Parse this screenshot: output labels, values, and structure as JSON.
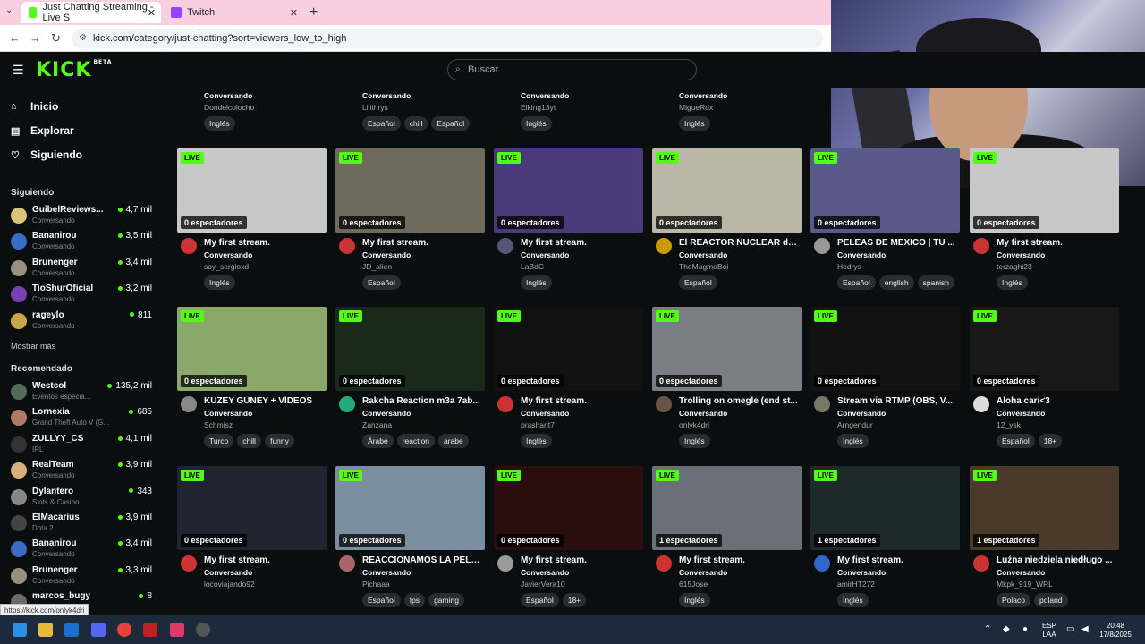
{
  "browser": {
    "tabs": [
      {
        "title": "Just Chatting Streaming - Live S",
        "active": true
      },
      {
        "title": "Twitch",
        "active": false
      }
    ],
    "url": "kick.com/category/just-chatting?sort=viewers_low_to_high",
    "status_url": "https://kick.com/onlyk4dri"
  },
  "header": {
    "logo": "KICK",
    "logo_badge": "BETA",
    "search_placeholder": "Buscar"
  },
  "sidebar": {
    "nav": [
      {
        "label": "Inicio",
        "icon": "home-icon"
      },
      {
        "label": "Explorar",
        "icon": "compass-icon"
      },
      {
        "label": "Siguiendo",
        "icon": "heart-icon"
      }
    ],
    "following_title": "Siguiendo",
    "following": [
      {
        "name": "GuibelReviews...",
        "category": "Conversando",
        "viewers": "4,7 mil",
        "color": "#d9c47a"
      },
      {
        "name": "Bananirou",
        "category": "Conversando",
        "viewers": "3,5 mil",
        "color": "#3a6cc8"
      },
      {
        "name": "Brunenger",
        "category": "Conversando",
        "viewers": "3,4 mil",
        "color": "#9a8f80"
      },
      {
        "name": "TioShurOficial",
        "category": "Conversando",
        "viewers": "3,2 mil",
        "color": "#7a3fb0"
      },
      {
        "name": "rageylo",
        "category": "Conversando",
        "viewers": "811",
        "color": "#c9a64a"
      }
    ],
    "show_more": "Mostrar más",
    "recommended_title": "Recomendado",
    "recommended": [
      {
        "name": "Westcol",
        "category": "Eventos especia...",
        "viewers": "135,2 mil",
        "color": "#556b5a"
      },
      {
        "name": "Lornexia",
        "category": "Grand Theft Auto V (G...",
        "viewers": "685",
        "color": "#b07a6a"
      },
      {
        "name": "ZULLYY_CS",
        "category": "IRL",
        "viewers": "4,1 mil",
        "color": "#333"
      },
      {
        "name": "RealTeam",
        "category": "Conversando",
        "viewers": "3,9 mil",
        "color": "#d9b07a"
      },
      {
        "name": "Dylantero",
        "category": "Slots & Casino",
        "viewers": "343",
        "color": "#888"
      },
      {
        "name": "ElMacarius",
        "category": "Dota 2",
        "viewers": "3,9 mil",
        "color": "#444"
      },
      {
        "name": "Bananirou",
        "category": "Conversando",
        "viewers": "3,4 mil",
        "color": "#3a6cc8"
      },
      {
        "name": "Brunenger",
        "category": "Conversando",
        "viewers": "3,3 mil",
        "color": "#9a8f80"
      },
      {
        "name": "marcos_bugy",
        "category": "",
        "viewers": "8",
        "color": "#6a6a6a"
      }
    ]
  },
  "top_row": [
    {
      "category": "Conversando",
      "user": "Dondelcolocho",
      "tags": [
        "Inglés"
      ]
    },
    {
      "category": "Conversando",
      "user": "Lilithrys",
      "tags": [
        "Español",
        "chill",
        "Español"
      ]
    },
    {
      "category": "Conversando",
      "user": "Elking13yt",
      "tags": [
        "Inglés"
      ]
    },
    {
      "category": "Conversando",
      "user": "MigueRdx",
      "tags": [
        "Inglés"
      ]
    }
  ],
  "grid": [
    [
      {
        "title": "My first stream.",
        "category": "Conversando",
        "user": "soy_sergioxd",
        "viewers": "0 espectadores",
        "tags": [
          "Inglés"
        ],
        "thumb": "#c8c8c8",
        "av": "#c33"
      },
      {
        "title": "My first stream.",
        "category": "Conversando",
        "user": "JD_alien",
        "viewers": "0 espectadores",
        "tags": [
          "Español"
        ],
        "thumb": "#6f6a5c",
        "av": "#c33"
      },
      {
        "title": "My first stream.",
        "category": "Conversando",
        "user": "LaBdC",
        "viewers": "0 espectadores",
        "tags": [
          "Inglés"
        ],
        "thumb": "#4a3a7a",
        "av": "#557"
      },
      {
        "title": "El REACTOR NUCLEAR de ...",
        "category": "Conversando",
        "user": "TheMagmaBoi",
        "viewers": "0 espectadores",
        "tags": [
          "Español"
        ],
        "thumb": "#bcb6a6",
        "av": "#c90"
      },
      {
        "title": "PELEAS DE MEXICO | TU ...",
        "category": "Conversando",
        "user": "Hedrys",
        "viewers": "0 espectadores",
        "tags": [
          "Español",
          "english",
          "spanish"
        ],
        "thumb": "#5a5a8a",
        "av": "#999"
      },
      {
        "title": "My first stream.",
        "category": "Conversando",
        "user": "terzaghi23",
        "viewers": "0 espectadores",
        "tags": [
          "Inglés"
        ],
        "thumb": "#c8c8c8",
        "av": "#c33"
      }
    ],
    [
      {
        "title": "KUZEY GÜNEY + VİDEOS",
        "category": "Conversando",
        "user": "Schmisz",
        "viewers": "0 espectadores",
        "tags": [
          "Turco",
          "chill",
          "funny"
        ],
        "thumb": "#8aa86a",
        "av": "#888"
      },
      {
        "title": "Rakcha Reaction m3a 7ab...",
        "category": "Conversando",
        "user": "Zanzana",
        "viewers": "0 espectadores",
        "tags": [
          "Árabe",
          "reaction",
          "arabe"
        ],
        "thumb": "#1a2a1a",
        "av": "#2a7"
      },
      {
        "title": "My first stream.",
        "category": "Conversando",
        "user": "prashant7",
        "viewers": "0 espectadores",
        "tags": [
          "Inglés"
        ],
        "thumb": "#111111",
        "av": "#c33"
      },
      {
        "title": "Trolling on omegle (end st...",
        "category": "Conversando",
        "user": "onlyk4dri",
        "viewers": "0 espectadores",
        "tags": [
          "Inglés"
        ],
        "thumb": "#7a7e84",
        "av": "#654"
      },
      {
        "title": "Stream via RTMP (OBS, V...",
        "category": "Conversando",
        "user": "Arngendur",
        "viewers": "0 espectadores",
        "tags": [
          "Inglés"
        ],
        "thumb": "#121212",
        "av": "#776"
      },
      {
        "title": "Aloha cari<3",
        "category": "Conversando",
        "user": "12_ysk",
        "viewers": "0 espectadores",
        "tags": [
          "Español",
          "18+"
        ],
        "thumb": "#181818",
        "av": "#ddd"
      }
    ],
    [
      {
        "title": "My first stream.",
        "category": "Conversando",
        "user": "locoviajando92",
        "viewers": "0 espectadores",
        "tags": [],
        "thumb": "#1f2530",
        "av": "#c33"
      },
      {
        "title": "REACCIONAMOS LA PELE...",
        "category": "Conversando",
        "user": "Pichaaa",
        "viewers": "0 espectadores",
        "tags": [
          "Español",
          "fps",
          "gaming"
        ],
        "thumb": "#7a8ea0",
        "av": "#a66"
      },
      {
        "title": "My first stream.",
        "category": "Conversando",
        "user": "JavierVera10",
        "viewers": "0 espectadores",
        "tags": [
          "Español",
          "18+"
        ],
        "thumb": "#2a0e0e",
        "av": "#999"
      },
      {
        "title": "My first stream.",
        "category": "Conversando",
        "user": "615Jose",
        "viewers": "1 espectadores",
        "tags": [
          "Inglés"
        ],
        "thumb": "#6a7078",
        "av": "#c33"
      },
      {
        "title": "My first stream.",
        "category": "Conversando",
        "user": "amirHT272",
        "viewers": "1 espectadores",
        "tags": [
          "Inglés"
        ],
        "thumb": "#1e2a2a",
        "av": "#36c"
      },
      {
        "title": "Luźna niedziela niedługo ...",
        "category": "Conversando",
        "user": "Mkpk_919_WRL",
        "viewers": "1 espectadores",
        "tags": [
          "Polaco",
          "poland"
        ],
        "thumb": "#4a3a2a",
        "av": "#c33"
      }
    ]
  ],
  "live_label": "LIVE",
  "taskbar": {
    "lang": "ESP",
    "lang2": "LAA",
    "time": "20:48",
    "date": "17/8/2025"
  }
}
